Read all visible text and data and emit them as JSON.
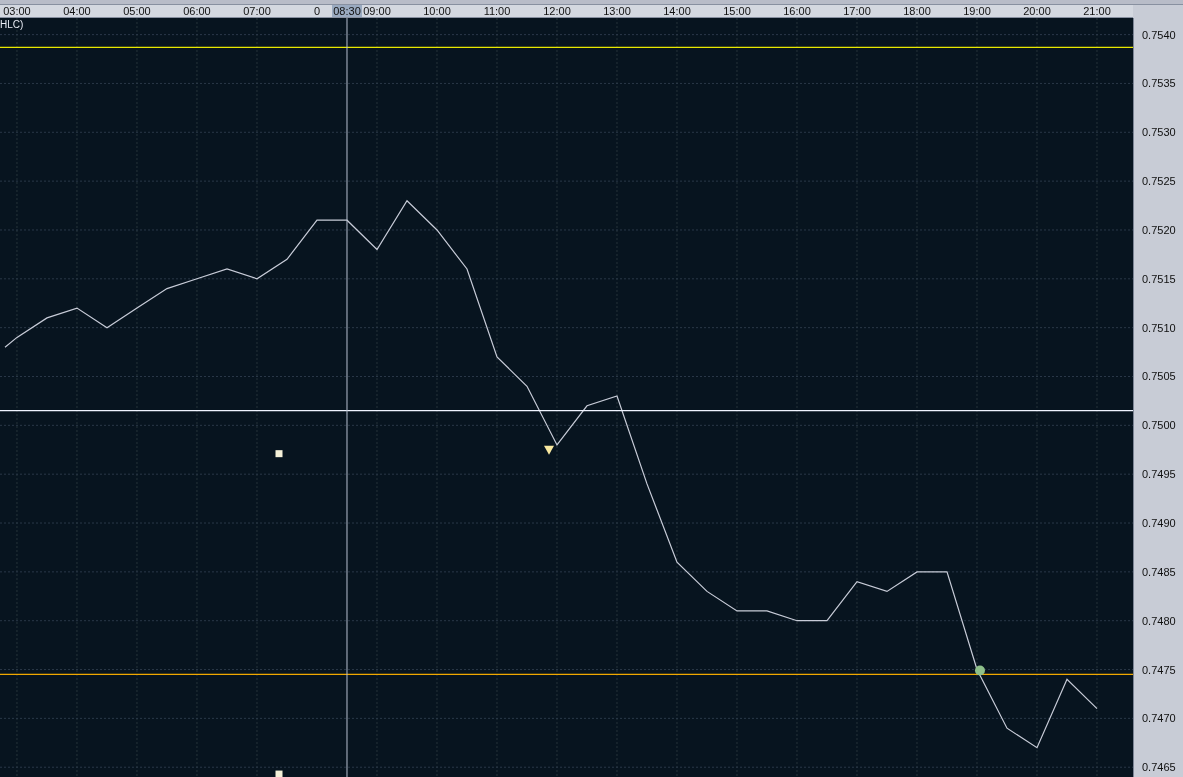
{
  "chart": {
    "legend_label": "HLC)",
    "chart_data": {
      "type": "line",
      "xlim": [
        2.717,
        21.6
      ],
      "ylim": [
        0.7464,
        0.75417
      ],
      "x": [
        2.8,
        3,
        3.5,
        4,
        4.5,
        5,
        5.5,
        6,
        6.5,
        7,
        7.5,
        8,
        8.5,
        9,
        9.5,
        10,
        10.5,
        11,
        11.5,
        12,
        12.5,
        13,
        13.5,
        14,
        14.5,
        15,
        15.5,
        16,
        16.5,
        17,
        17.5,
        18,
        18.5,
        19,
        19.5,
        20,
        20.5,
        21
      ],
      "series": [
        {
          "color": "#c8ccd8",
          "values": [
            0.7508,
            0.7509,
            0.7511,
            0.7512,
            0.751,
            0.7512,
            0.7514,
            0.7515,
            0.7516,
            0.7515,
            0.7517,
            0.7521,
            0.7521,
            0.7518,
            0.7523,
            0.752,
            0.7516,
            0.7507,
            0.7504,
            0.7498,
            0.7502,
            0.7503,
            0.7494,
            0.7486,
            0.7483,
            0.7481,
            0.7481,
            0.748,
            0.748,
            0.7484,
            0.7483,
            0.7485,
            0.7485,
            0.7475,
            0.7469,
            0.7467,
            0.7474,
            0.7471
          ]
        }
      ],
      "xticks": [
        {
          "value": 3,
          "label": "03:00"
        },
        {
          "value": 4,
          "label": "04:00"
        },
        {
          "value": 5,
          "label": "05:00"
        },
        {
          "value": 6,
          "label": "06:00"
        },
        {
          "value": 7,
          "label": "07:00"
        },
        {
          "value": 9,
          "label": "09:00"
        },
        {
          "value": 10,
          "label": "10:00"
        },
        {
          "value": 11,
          "label": "11:00"
        },
        {
          "value": 12,
          "label": "12:00"
        },
        {
          "value": 13,
          "label": "13:00"
        },
        {
          "value": 14,
          "label": "14:00"
        },
        {
          "value": 15,
          "label": "15:00"
        },
        {
          "value": 16,
          "label": "16:00"
        },
        {
          "value": 17,
          "label": "17:00"
        },
        {
          "value": 18,
          "label": "18:00"
        },
        {
          "value": 19,
          "label": "19:00"
        },
        {
          "value": 20,
          "label": "20:00"
        },
        {
          "value": 21,
          "label": "21:00"
        }
      ],
      "yticks": [
        {
          "value": 0.754,
          "label": "0.7540"
        },
        {
          "value": 0.7535,
          "label": "0.7535"
        },
        {
          "value": 0.753,
          "label": "0.7530"
        },
        {
          "value": 0.7525,
          "label": "0.7525"
        },
        {
          "value": 0.752,
          "label": "0.7520"
        },
        {
          "value": 0.7515,
          "label": "0.7515"
        },
        {
          "value": 0.751,
          "label": "0.7510"
        },
        {
          "value": 0.7505,
          "label": "0.7505"
        },
        {
          "value": 0.75,
          "label": "0.7500"
        },
        {
          "value": 0.7495,
          "label": "0.7495"
        },
        {
          "value": 0.749,
          "label": "0.7490"
        },
        {
          "value": 0.7485,
          "label": "0.7485"
        },
        {
          "value": 0.748,
          "label": "0.7480"
        },
        {
          "value": 0.7475,
          "label": "0.7475"
        },
        {
          "value": 0.747,
          "label": "0.7470"
        },
        {
          "value": 0.7465,
          "label": "0.7465"
        }
      ],
      "grid": true,
      "ref_lines": [
        {
          "axis": "y",
          "value": 0.75387,
          "color": "#e8e800"
        },
        {
          "axis": "y",
          "value": 0.75015,
          "color": "#f0f4ff"
        },
        {
          "axis": "y",
          "value": 0.74745,
          "color": "#f0a800"
        },
        {
          "axis": "x",
          "value": 8.5,
          "label": "08:30",
          "color": "#b8c0d0"
        }
      ]
    },
    "covered_tick_label": {
      "label": "0"
    },
    "overlays": [
      {
        "kind": "square"
      },
      {
        "kind": "square"
      },
      {
        "kind": "triangle"
      },
      {
        "kind": "circle"
      }
    ]
  }
}
